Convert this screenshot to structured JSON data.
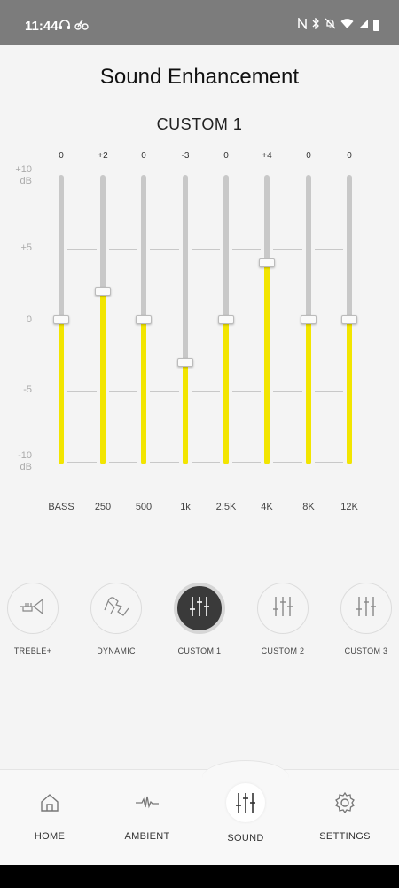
{
  "status_bar": {
    "time": "11:44",
    "left_icons": [
      "headphones-icon",
      "bicycle-icon"
    ],
    "right_icons": [
      "nfc-icon",
      "bluetooth-icon",
      "mute-icon",
      "wifi-icon",
      "signal-icon",
      "battery-icon"
    ]
  },
  "page_title": "Sound Enhancement",
  "preset_title": "CUSTOM 1",
  "db_scale": [
    "+10\ndB",
    "+5",
    "0",
    "-5",
    "-10\ndB"
  ],
  "equalizer": {
    "track_color": "#c8c8c8",
    "fill_color": "#f2e500",
    "range": [
      -10,
      10
    ],
    "bands": [
      {
        "label": "BASS",
        "value_text": "0",
        "value": 0
      },
      {
        "label": "250",
        "value_text": "+2",
        "value": 2
      },
      {
        "label": "500",
        "value_text": "0",
        "value": 0
      },
      {
        "label": "1k",
        "value_text": "-3",
        "value": -3
      },
      {
        "label": "2.5K",
        "value_text": "0",
        "value": 0
      },
      {
        "label": "4K",
        "value_text": "+4",
        "value": 4
      },
      {
        "label": "8K",
        "value_text": "0",
        "value": 0
      },
      {
        "label": "12K",
        "value_text": "0",
        "value": 0
      }
    ]
  },
  "presets": [
    {
      "label": "TREBLE+",
      "icon": "trumpet-icon",
      "active": false
    },
    {
      "label": "DYNAMIC",
      "icon": "dynamic-icon",
      "active": false
    },
    {
      "label": "CUSTOM 1",
      "icon": "sliders-icon",
      "active": true
    },
    {
      "label": "CUSTOM 2",
      "icon": "sliders-icon",
      "active": false
    },
    {
      "label": "CUSTOM 3",
      "icon": "sliders-icon",
      "active": false
    }
  ],
  "bottom_nav": [
    {
      "label": "HOME",
      "icon": "home-icon",
      "active": false
    },
    {
      "label": "AMBIENT",
      "icon": "ambient-wave-icon",
      "active": false
    },
    {
      "label": "SOUND",
      "icon": "sound-sliders-icon",
      "active": true
    },
    {
      "label": "SETTINGS",
      "icon": "gear-icon",
      "active": false
    }
  ]
}
